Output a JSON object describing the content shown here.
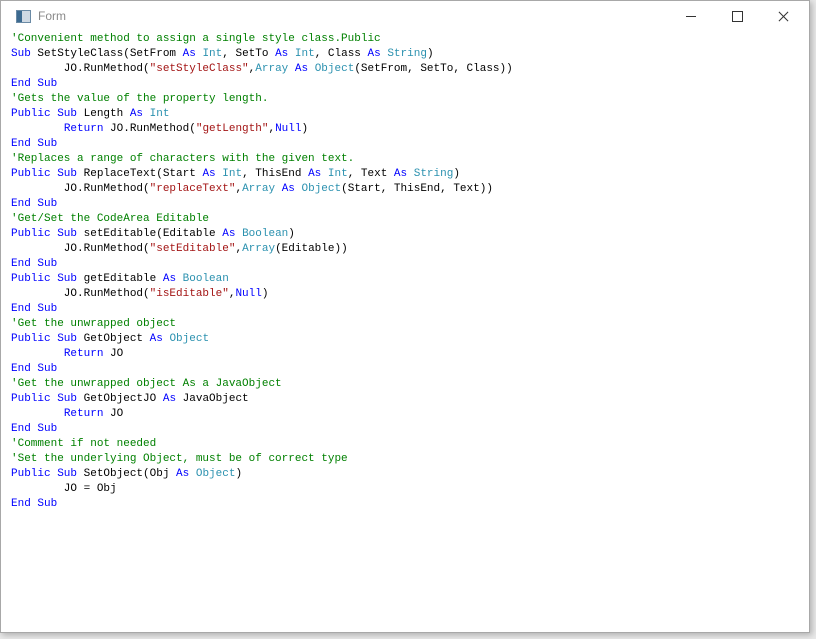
{
  "window": {
    "title": "Form",
    "minimize_icon": "minimize-icon",
    "maximize_icon": "maximize-icon",
    "close_icon": "close-icon"
  },
  "colors": {
    "keyword": "#0000ff",
    "comment": "#008000",
    "type": "#2b91af",
    "string": "#a31515"
  },
  "code_lines": [
    [
      [
        "c",
        "'Convenient method to assign a single style class.Public"
      ]
    ],
    [
      [
        "k",
        "Sub"
      ],
      [
        "p",
        " SetStyleClass(SetFrom "
      ],
      [
        "k",
        "As"
      ],
      [
        "p",
        " "
      ],
      [
        "t",
        "Int"
      ],
      [
        "p",
        ", SetTo "
      ],
      [
        "k",
        "As"
      ],
      [
        "p",
        " "
      ],
      [
        "t",
        "Int"
      ],
      [
        "p",
        ", Class "
      ],
      [
        "k",
        "As"
      ],
      [
        "p",
        " "
      ],
      [
        "t",
        "String"
      ],
      [
        "p",
        ")"
      ]
    ],
    [
      [
        "p",
        "        JO.RunMethod("
      ],
      [
        "s",
        "\"setStyleClass\""
      ],
      [
        "p",
        ","
      ],
      [
        "t",
        "Array"
      ],
      [
        "p",
        " "
      ],
      [
        "k",
        "As"
      ],
      [
        "p",
        " "
      ],
      [
        "t",
        "Object"
      ],
      [
        "p",
        "(SetFrom, SetTo, Class))"
      ]
    ],
    [
      [
        "k",
        "End Sub"
      ]
    ],
    [
      [
        "c",
        "'Gets the value of the property length."
      ]
    ],
    [
      [
        "k",
        "Public Sub"
      ],
      [
        "p",
        " Length "
      ],
      [
        "k",
        "As"
      ],
      [
        "p",
        " "
      ],
      [
        "t",
        "Int"
      ]
    ],
    [
      [
        "p",
        "        "
      ],
      [
        "k",
        "Return"
      ],
      [
        "p",
        " JO.RunMethod("
      ],
      [
        "s",
        "\"getLength\""
      ],
      [
        "p",
        ","
      ],
      [
        "k",
        "Null"
      ],
      [
        "p",
        ")"
      ]
    ],
    [
      [
        "k",
        "End Sub"
      ]
    ],
    [
      [
        "c",
        "'Replaces a range of characters with the given text."
      ]
    ],
    [
      [
        "k",
        "Public Sub"
      ],
      [
        "p",
        " ReplaceText(Start "
      ],
      [
        "k",
        "As"
      ],
      [
        "p",
        " "
      ],
      [
        "t",
        "Int"
      ],
      [
        "p",
        ", ThisEnd "
      ],
      [
        "k",
        "As"
      ],
      [
        "p",
        " "
      ],
      [
        "t",
        "Int"
      ],
      [
        "p",
        ", Text "
      ],
      [
        "k",
        "As"
      ],
      [
        "p",
        " "
      ],
      [
        "t",
        "String"
      ],
      [
        "p",
        ")"
      ]
    ],
    [
      [
        "p",
        "        JO.RunMethod("
      ],
      [
        "s",
        "\"replaceText\""
      ],
      [
        "p",
        ","
      ],
      [
        "t",
        "Array"
      ],
      [
        "p",
        " "
      ],
      [
        "k",
        "As"
      ],
      [
        "p",
        " "
      ],
      [
        "t",
        "Object"
      ],
      [
        "p",
        "(Start, ThisEnd, Text))"
      ]
    ],
    [
      [
        "k",
        "End Sub"
      ]
    ],
    [
      [
        "c",
        "'Get/Set the CodeArea Editable"
      ]
    ],
    [
      [
        "k",
        "Public Sub"
      ],
      [
        "p",
        " setEditable(Editable "
      ],
      [
        "k",
        "As"
      ],
      [
        "p",
        " "
      ],
      [
        "t",
        "Boolean"
      ],
      [
        "p",
        ")"
      ]
    ],
    [
      [
        "p",
        "        JO.RunMethod("
      ],
      [
        "s",
        "\"setEditable\""
      ],
      [
        "p",
        ","
      ],
      [
        "t",
        "Array"
      ],
      [
        "p",
        "(Editable))"
      ]
    ],
    [
      [
        "k",
        "End Sub"
      ]
    ],
    [
      [
        "k",
        "Public Sub"
      ],
      [
        "p",
        " getEditable "
      ],
      [
        "k",
        "As"
      ],
      [
        "p",
        " "
      ],
      [
        "t",
        "Boolean"
      ]
    ],
    [
      [
        "p",
        "        JO.RunMethod("
      ],
      [
        "s",
        "\"isEditable\""
      ],
      [
        "p",
        ","
      ],
      [
        "k",
        "Null"
      ],
      [
        "p",
        ")"
      ]
    ],
    [
      [
        "k",
        "End Sub"
      ]
    ],
    [
      [
        "c",
        "'Get the unwrapped object"
      ]
    ],
    [
      [
        "k",
        "Public Sub"
      ],
      [
        "p",
        " GetObject "
      ],
      [
        "k",
        "As"
      ],
      [
        "p",
        " "
      ],
      [
        "t",
        "Object"
      ]
    ],
    [
      [
        "p",
        "        "
      ],
      [
        "k",
        "Return"
      ],
      [
        "p",
        " JO"
      ]
    ],
    [
      [
        "k",
        "End Sub"
      ]
    ],
    [
      [
        "c",
        "'Get the unwrapped object As a JavaObject"
      ]
    ],
    [
      [
        "k",
        "Public Sub"
      ],
      [
        "p",
        " GetObjectJO "
      ],
      [
        "k",
        "As"
      ],
      [
        "p",
        " JavaObject"
      ]
    ],
    [
      [
        "p",
        "        "
      ],
      [
        "k",
        "Return"
      ],
      [
        "p",
        " JO"
      ]
    ],
    [
      [
        "k",
        "End Sub"
      ]
    ],
    [
      [
        "c",
        "'Comment if not needed"
      ]
    ],
    [
      [
        "c",
        "'Set the underlying Object, must be of correct type"
      ]
    ],
    [
      [
        "k",
        "Public Sub"
      ],
      [
        "p",
        " SetObject(Obj "
      ],
      [
        "k",
        "As"
      ],
      [
        "p",
        " "
      ],
      [
        "t",
        "Object"
      ],
      [
        "p",
        ")"
      ]
    ],
    [
      [
        "p",
        "        JO = Obj"
      ]
    ],
    [
      [
        "k",
        "End Sub"
      ]
    ]
  ]
}
